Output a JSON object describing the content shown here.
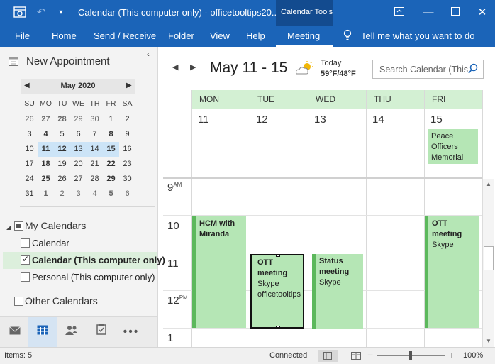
{
  "titlebar": {
    "title": "Calendar (This computer only) - officetooltips20...",
    "context_tab": "Calendar Tools"
  },
  "ribbon": {
    "tabs": [
      "File",
      "Home",
      "Send / Receive",
      "Folder",
      "View",
      "Help",
      "Meeting"
    ],
    "active_tab": "Meeting",
    "tell_me": "Tell me what you want to do"
  },
  "left_pane": {
    "new_appointment": "New Appointment",
    "mini_calendar": {
      "month": "May 2020",
      "weekdays": [
        "SU",
        "MO",
        "TU",
        "WE",
        "TH",
        "FR",
        "SA"
      ],
      "weeks": [
        [
          "26",
          "27",
          "28",
          "29",
          "30",
          "1",
          "2"
        ],
        [
          "3",
          "4",
          "5",
          "6",
          "7",
          "8",
          "9"
        ],
        [
          "10",
          "11",
          "12",
          "13",
          "14",
          "15",
          "16"
        ],
        [
          "17",
          "18",
          "19",
          "20",
          "21",
          "22",
          "23"
        ],
        [
          "24",
          "25",
          "26",
          "27",
          "28",
          "29",
          "30"
        ],
        [
          "31",
          "1",
          "2",
          "3",
          "4",
          "5",
          "6"
        ]
      ]
    },
    "my_calendars": "My Calendars",
    "calendars": [
      {
        "label": "Calendar",
        "checked": false
      },
      {
        "label": "Calendar (This computer only)",
        "checked": true
      },
      {
        "label": "Personal (This computer only)",
        "checked": false
      }
    ],
    "other_calendars": "Other Calendars"
  },
  "calendar": {
    "range": "May 11 - 15",
    "weather_day": "Today",
    "weather_temp": "59°F/48°F",
    "search_placeholder": "Search Calendar (This",
    "days": [
      {
        "name": "MON",
        "num": "11"
      },
      {
        "name": "TUE",
        "num": "12"
      },
      {
        "name": "WED",
        "num": "13"
      },
      {
        "name": "THU",
        "num": "14"
      },
      {
        "name": "FRI",
        "num": "15"
      }
    ],
    "hours": [
      {
        "h": "9",
        "ampm": "AM"
      },
      {
        "h": "10",
        "ampm": ""
      },
      {
        "h": "11",
        "ampm": ""
      },
      {
        "h": "12",
        "ampm": "PM"
      },
      {
        "h": "1",
        "ampm": ""
      }
    ],
    "allday_event": {
      "text": "Peace Officers Memorial D..."
    },
    "appointments": [
      {
        "title": "HCM with Miranda",
        "location": ""
      },
      {
        "title": "OTT meeting",
        "location": "Skype officetooltips"
      },
      {
        "title": "Status meeting",
        "location": "Skype"
      },
      {
        "title": "OTT meeting",
        "location": "Skype"
      }
    ]
  },
  "status": {
    "items": "Items: 5",
    "connection": "Connected",
    "zoom": "100%"
  },
  "colors": {
    "brand": "#1b64b8",
    "context_group": "#134b8f",
    "appointment": "#b5e6b5",
    "appointment_bar": "#5cb85c",
    "day_header": "#d3f0d3",
    "selection": "#cce4f7"
  }
}
